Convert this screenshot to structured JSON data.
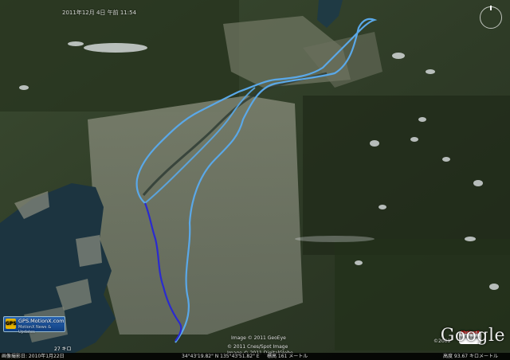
{
  "map": {
    "timestamp_top": "2011年12月 4日 午前 11:54",
    "copyright_lines": [
      "Image © 2011 GeoEye",
      "© 2011 Cnes/Spot Image",
      "Image © 2011 DigitalGlobe"
    ],
    "year": "©2009",
    "brand": "Google",
    "motionx_label": "MotionX",
    "motionx_sub": "by Fullpower",
    "gps_badge_title": "GPS.MotionX.com",
    "gps_badge_sub": "MotionX News & Updates",
    "scale": "27 キロ",
    "status": {
      "capture_date": "画像撮影日: 2010年1月22日",
      "coordinates": "34°43'19.82\" N  135°43'51.82\" E",
      "elevation": "標高  161 メートル",
      "altitude": "高度  93.67 キロメートル"
    },
    "colors": {
      "route_light": "#5aa8e8",
      "route_dark": "#2a2ad0",
      "water": "#1c3440"
    }
  }
}
